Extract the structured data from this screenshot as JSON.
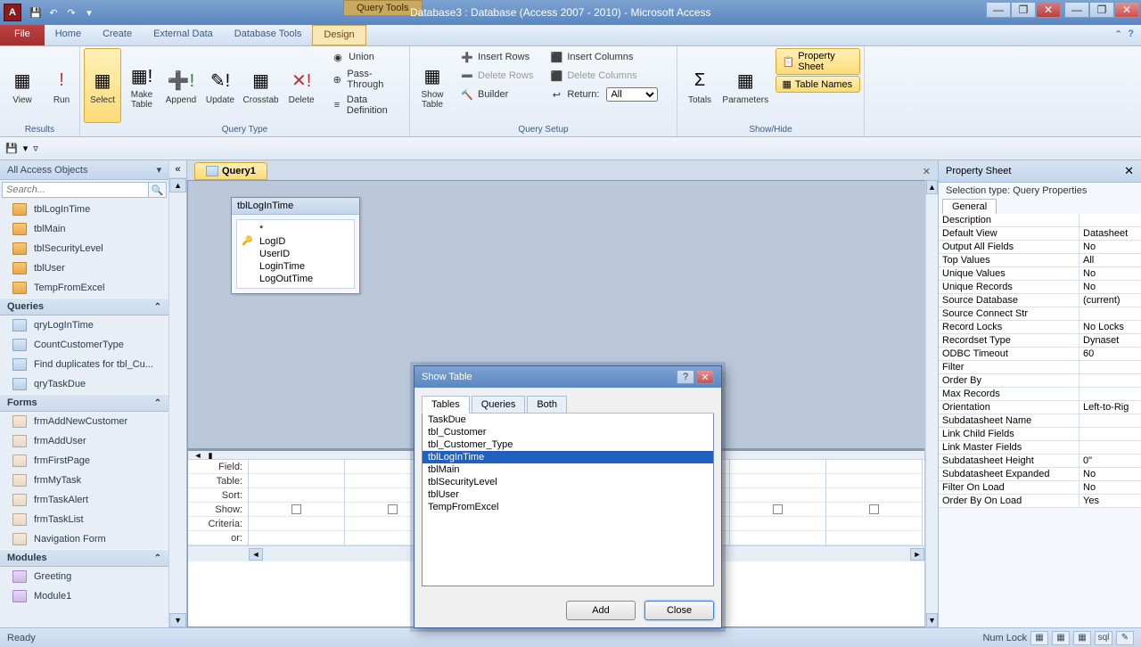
{
  "title": "Database3 : Database (Access 2007 - 2010) - Microsoft Access",
  "context_tab": "Query Tools",
  "menu": {
    "file": "File",
    "home": "Home",
    "create": "Create",
    "external": "External Data",
    "dbtools": "Database Tools",
    "design": "Design"
  },
  "ribbon": {
    "results": {
      "view": "View",
      "run": "Run",
      "label": "Results"
    },
    "qtype": {
      "select": "Select",
      "make": "Make\nTable",
      "append": "Append",
      "update": "Update",
      "crosstab": "Crosstab",
      "delete": "Delete",
      "union": "Union",
      "pass": "Pass-Through",
      "datadef": "Data Definition",
      "label": "Query Type"
    },
    "setup": {
      "show": "Show\nTable",
      "insr": "Insert Rows",
      "delr": "Delete Rows",
      "builder": "Builder",
      "insc": "Insert Columns",
      "delc": "Delete Columns",
      "return": "Return:",
      "returnval": "All",
      "label": "Query Setup"
    },
    "showhide": {
      "totals": "Totals",
      "params": "Parameters",
      "prop": "Property Sheet",
      "tnames": "Table Names",
      "label": "Show/Hide"
    }
  },
  "nav": {
    "header": "All Access Objects",
    "search": "Search...",
    "tables": [
      "tblLogInTime",
      "tblMain",
      "tblSecurityLevel",
      "tblUser",
      "TempFromExcel"
    ],
    "queries_label": "Queries",
    "queries": [
      "qryLogInTime",
      "CountCustomerType",
      "Find duplicates for tbl_Cu...",
      "qryTaskDue"
    ],
    "forms_label": "Forms",
    "forms": [
      "frmAddNewCustomer",
      "frmAddUser",
      "frmFirstPage",
      "frmMyTask",
      "frmTaskAlert",
      "frmTaskList",
      "Navigation Form"
    ],
    "modules_label": "Modules",
    "modules": [
      "Greeting",
      "Module1"
    ]
  },
  "doc": {
    "tab": "Query1"
  },
  "table_win": {
    "title": "tblLogInTime",
    "fields": [
      "*",
      "LogID",
      "UserID",
      "LoginTime",
      "LogOutTime"
    ],
    "key": 1
  },
  "grid_labels": [
    "Field:",
    "Table:",
    "Sort:",
    "Show:",
    "Criteria:",
    "or:"
  ],
  "props": {
    "title": "Property Sheet",
    "seltype": "Selection type:  Query Properties",
    "tab": "General",
    "rows": [
      [
        "Description",
        ""
      ],
      [
        "Default View",
        "Datasheet"
      ],
      [
        "Output All Fields",
        "No"
      ],
      [
        "Top Values",
        "All"
      ],
      [
        "Unique Values",
        "No"
      ],
      [
        "Unique Records",
        "No"
      ],
      [
        "Source Database",
        "(current)"
      ],
      [
        "Source Connect Str",
        ""
      ],
      [
        "Record Locks",
        "No Locks"
      ],
      [
        "Recordset Type",
        "Dynaset"
      ],
      [
        "ODBC Timeout",
        "60"
      ],
      [
        "Filter",
        ""
      ],
      [
        "Order By",
        ""
      ],
      [
        "Max Records",
        ""
      ],
      [
        "Orientation",
        "Left-to-Rig"
      ],
      [
        "Subdatasheet Name",
        ""
      ],
      [
        "Link Child Fields",
        ""
      ],
      [
        "Link Master Fields",
        ""
      ],
      [
        "Subdatasheet Height",
        "0\""
      ],
      [
        "Subdatasheet Expanded",
        "No"
      ],
      [
        "Filter On Load",
        "No"
      ],
      [
        "Order By On Load",
        "Yes"
      ]
    ]
  },
  "dialog": {
    "title": "Show Table",
    "tabs": [
      "Tables",
      "Queries",
      "Both"
    ],
    "items": [
      "TaskDue",
      "tbl_Customer",
      "tbl_Customer_Type",
      "tblLogInTime",
      "tblMain",
      "tblSecurityLevel",
      "tblUser",
      "TempFromExcel"
    ],
    "selected": 3,
    "add": "Add",
    "close": "Close"
  },
  "status": {
    "ready": "Ready",
    "numlock": "Num Lock"
  }
}
